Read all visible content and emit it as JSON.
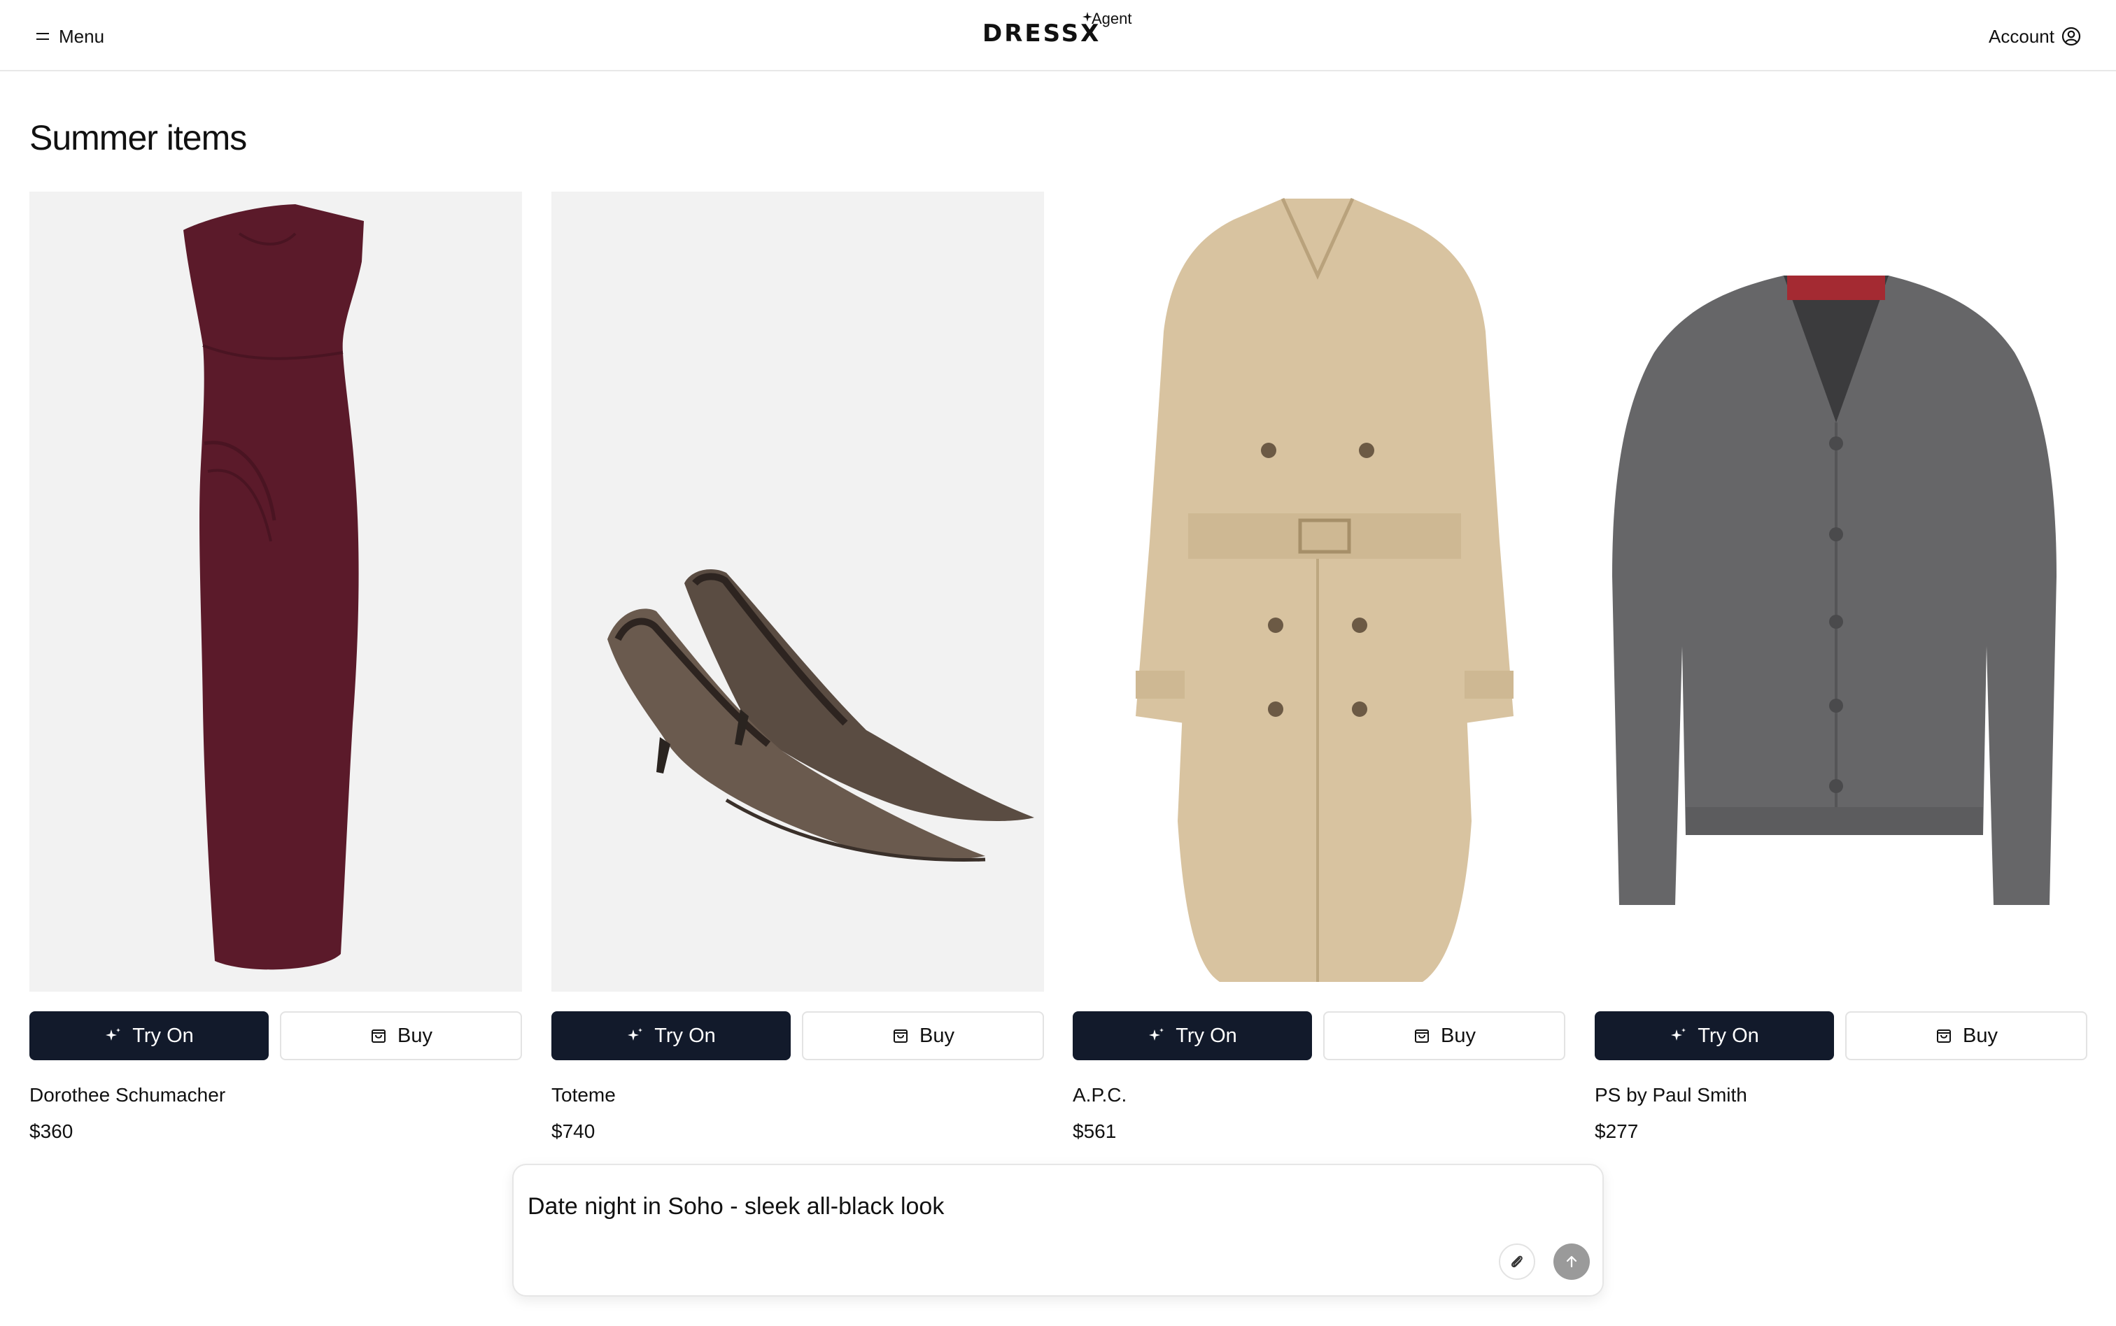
{
  "header": {
    "menu_label": "Menu",
    "logo_text": "DRESSX",
    "logo_suffix": "Agent",
    "account_label": "Account"
  },
  "section": {
    "title": "Summer items"
  },
  "products": [
    {
      "brand": "Dorothee Schumacher",
      "price": "$360",
      "try_on_label": "Try On",
      "buy_label": "Buy",
      "item": "burgundy midi dress"
    },
    {
      "brand": "Toteme",
      "price": "$740",
      "try_on_label": "Try On",
      "buy_label": "Buy",
      "item": "brown slingback pumps"
    },
    {
      "brand": "A.P.C.",
      "price": "$561",
      "try_on_label": "Try On",
      "buy_label": "Buy",
      "item": "beige trench coat"
    },
    {
      "brand": "PS by Paul Smith",
      "price": "$277",
      "try_on_label": "Try On",
      "buy_label": "Buy",
      "item": "grey cardigan"
    }
  ],
  "prompt": {
    "value": "Date night in Soho - sleek all-black look"
  },
  "icons": {
    "menu": "menu-icon",
    "account": "user-circle-icon",
    "try_on": "sparkle-icon",
    "buy": "shopping-bag-icon",
    "attach": "paperclip-icon",
    "send": "arrow-up-icon"
  },
  "colors": {
    "primary_button": "#121a2b",
    "image_bg": "#f2f2f2",
    "send_button": "#9a9a9a"
  }
}
